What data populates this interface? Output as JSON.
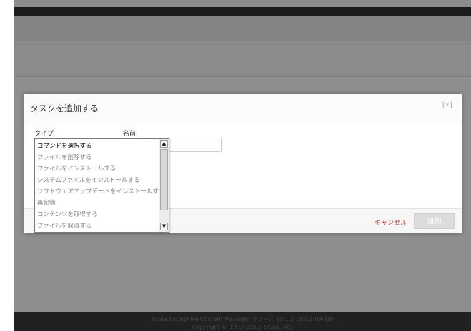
{
  "app": {
    "footer_line1": "Scala Enterprise Content Manager リリース 10.1.2 (2013-09-18)",
    "footer_line2": "Copyright © 1993-2013, Scala, Inc."
  },
  "dialog": {
    "title": "タスクを追加する",
    "close_label": "[×]",
    "type_label": "タイプ",
    "name_label": "名前",
    "name_value": "",
    "cancel_label": "キャンセル",
    "add_label": "追加"
  },
  "dropdown": {
    "selected_index": 0,
    "options": [
      "コマンドを選択する",
      "ファイルを削除する",
      "ファイルをインストールする",
      "システムファイルをインストールする",
      "ソフトウェアアップデートをインストールする",
      "再起動",
      "コンテンツを取得する",
      "ファイルを取得する"
    ],
    "scroll_up_icon": "scroll-up-arrow-icon",
    "scroll_down_icon": "scroll-down-arrow-icon"
  },
  "colors": {
    "cancel": "#d9342b",
    "add_button_bg": "#dcdcdc",
    "overlay": "rgba(0,0,0,0.42)"
  }
}
